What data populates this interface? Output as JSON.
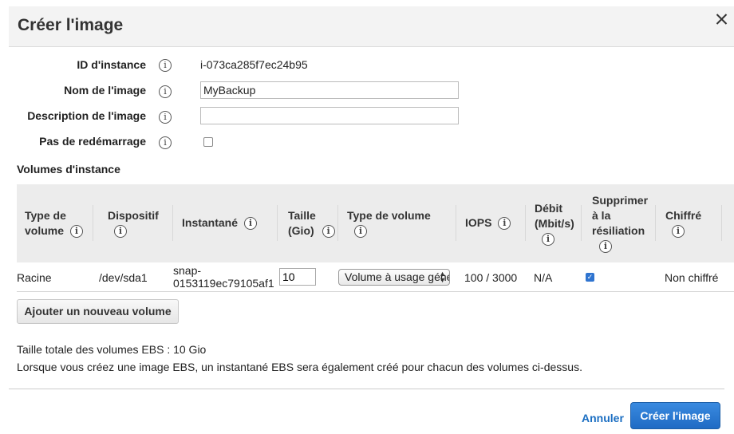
{
  "dialog": {
    "title": "Créer l'image"
  },
  "form": {
    "instance_id_label": "ID d'instance",
    "instance_id_value": "i-073ca285f7ec24b95",
    "image_name_label": "Nom de l'image",
    "image_name_value": "MyBackup",
    "image_description_label": "Description de l'image",
    "image_description_value": "",
    "no_reboot_label": "Pas de redémarrage",
    "no_reboot_checked": false
  },
  "volumes": {
    "section_title": "Volumes d'instance",
    "headers": {
      "type_line1": "Type de",
      "type_line2": "volume",
      "device": "Dispositif",
      "snapshot": "Instantané",
      "size_line1": "Taille",
      "size_line2": "(Gio)",
      "volume_type": "Type de volume",
      "iops": "IOPS",
      "throughput_line1": "Débit",
      "throughput_line2": "(Mbit/s)",
      "delete_line1": "Supprimer",
      "delete_line2": "à la",
      "delete_line3": "résiliation",
      "encrypted": "Chiffré"
    },
    "rows": [
      {
        "type": "Racine",
        "device": "/dev/sda1",
        "snapshot_line1": "snap-",
        "snapshot_line2": "0153119ec79105af1",
        "size": "10",
        "volume_type": "Volume à usage général",
        "iops": "100 / 3000",
        "throughput": "N/A",
        "delete_on_termination": true,
        "encrypted": "Non chiffré"
      }
    ],
    "add_volume_button": "Ajouter un nouveau volume"
  },
  "summary": {
    "total_size": "Taille totale des volumes EBS : 10 Gio",
    "note": "Lorsque vous créez une image EBS, un instantané EBS sera également créé pour chacun des volumes ci-dessus."
  },
  "actions": {
    "cancel": "Annuler",
    "create": "Créer l'image"
  },
  "icons": {
    "info": "info-icon",
    "close": "close-icon",
    "select_arrows": "select-arrows-icon",
    "checkmark": "checkmark-icon"
  },
  "colors": {
    "primary_button": "#1f6bc4",
    "link": "#1b6ec2",
    "checkbox_checked": "#2f74d0"
  }
}
